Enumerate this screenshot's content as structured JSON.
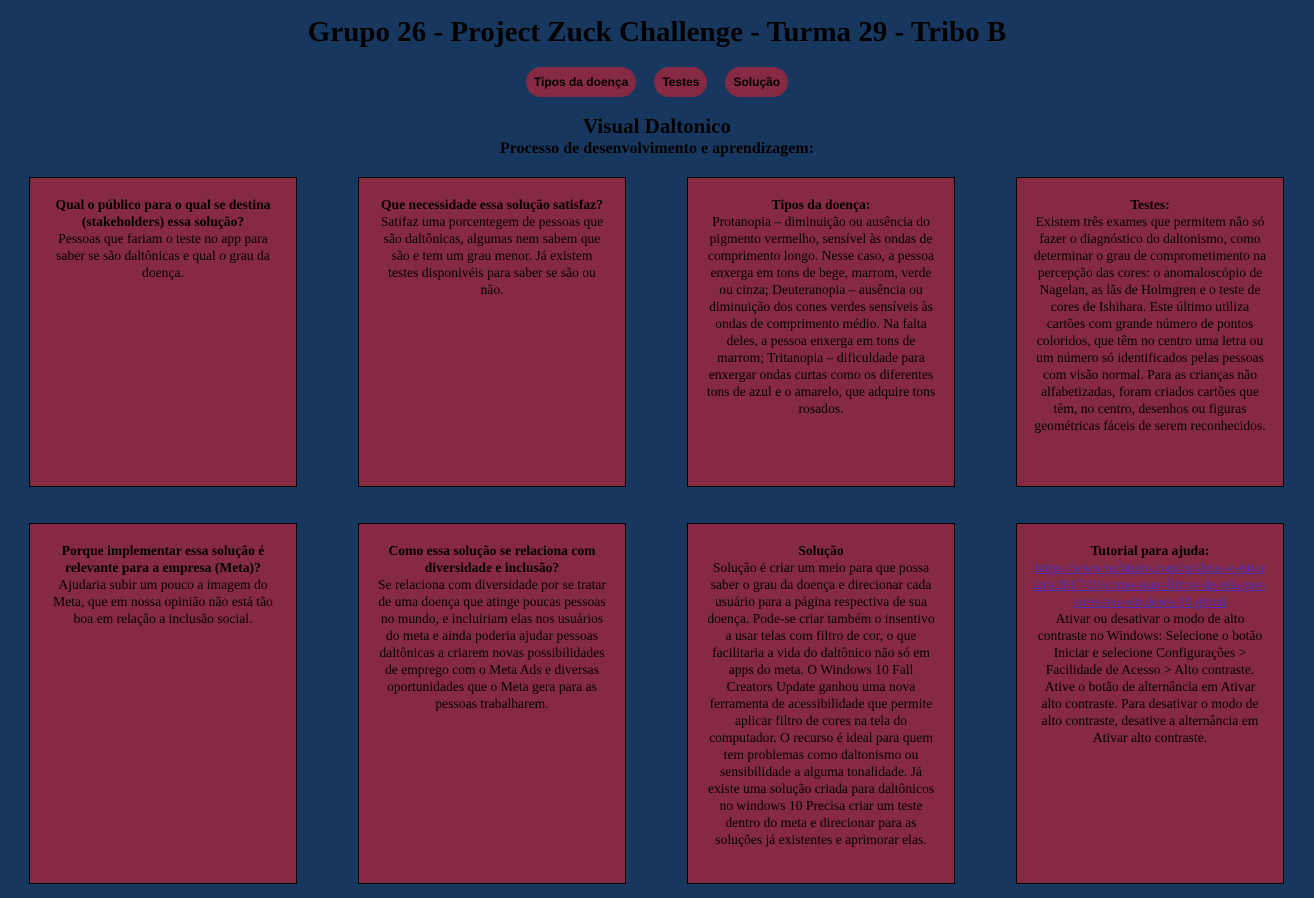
{
  "header": {
    "title": "Grupo 26 - Project Zuck Challenge - Turma 29 - Tribo B"
  },
  "nav": {
    "items": [
      "Tipos da doença",
      "Testes",
      "Solução"
    ]
  },
  "intro": {
    "title": "Visual Daltonico",
    "subtitle": "Processo de desenvolvimento e aprendizagem:"
  },
  "colors": {
    "background": "#17375e",
    "card": "#862a44",
    "link": "#4b2fb0"
  },
  "cards": [
    {
      "title": "Qual o público para o qual se destina (stakeholders) essa solução?",
      "body": "Pessoas que fariam o teste no app para saber se são daltônicas e qual o grau da doença."
    },
    {
      "title": "Que necessidade essa solução satisfaz?",
      "body": "Satifaz uma porcentegem de pessoas que são daltônicas, algumas nem sabem que são e tem um grau menor. Já existem testes disponivéis para saber se são ou não."
    },
    {
      "title": "Tipos da doença:",
      "body": "Protanopia – diminuição ou ausência do pigmento vermelho, sensível às ondas de comprimento longo. Nesse caso, a pessoa enxerga em tons de bege, marrom, verde ou cinza; Deuteranopia – ausência ou diminuição dos cones verdes sensíveis às ondas de comprimento médio. Na falta deles, a pessoa enxerga em tons de marrom; Tritanopia – dificuldade para enxergar ondas curtas como os diferentes tons de azul e o amarelo, que adquire tons rosados."
    },
    {
      "title": "Testes:",
      "body": "Existem três exames que permitem não só fazer o diagnóstico do daltonismo, como determinar o grau de comprometimento na percepção das cores: o anomaloscópio de Nagelan, as lãs de Holmgren e o teste de cores de Ishihara. Este último utiliza cartões com grande número de pontos coloridos, que têm no centro uma letra ou um número só identificados pelas pessoas com visão normal. Para as crianças não alfabetizadas, foram criados cartões que têm, no centro, desenhos ou figuras geométricas fáceis de serem reconhecidos."
    },
    {
      "title": "Porque implementar essa solução é relevante para a empresa (Meta)?",
      "body": "Ajudaria subir um pouco a imagem do Meta, que em nossa opinião não está tão boa em relação a inclusão social."
    },
    {
      "title": "Como essa solução se relaciona com diversidade e inclusão?",
      "body": "Se relaciona com diversidade por se tratar de uma doença que atinge poucas pessoas no mundo, e incluiriam elas nos usuários do meta e ainda poderia ajudar pessoas daltônicas a criarem novas possibilidades de emprego com o Meta Ads e diversas oportunidades que o Meta gera para as pessoas trabalharem."
    },
    {
      "title": "Solução",
      "body": "Solução é criar um meio para que possa saber o grau da doença e direcionar cada usuário para a página respectiva de sua doença. Pode-se criar também o insentivo a usar telas com filtro de cor, o que facilitaria a vida do daltônico não só em apps do meta. O Windows 10 Fall Creators Update ganhou uma nova ferramenta de acessibilidade que permite aplicar filtro de cores na tela do computador. O recurso é ideal para quem tem problemas como daltonismo ou sensibilidade a alguma tonalidade. Já existe uma solução criada para daltônicos no windows 10 Precisa criar um teste dentro do meta e direcionar para as soluções já existentes e aprimorar elas."
    },
    {
      "title": "Tutorial para ajuda:",
      "link": "https://www.techtudo.com.br/dicas-e-tutoriais/2017/10/como-usar-filtros-de-tela-por-cores-no-windows-10.ghtml",
      "body": "Ativar ou desativar o modo de alto contraste no Windows: Selecione o botão Iniciar e selecione Configurações > Facilidade de Acesso > Alto contraste. Ative o botão de alternância em Ativar alto contraste. Para desativar o modo de alto contraste, desative a alternância em Ativar alto contraste."
    }
  ]
}
